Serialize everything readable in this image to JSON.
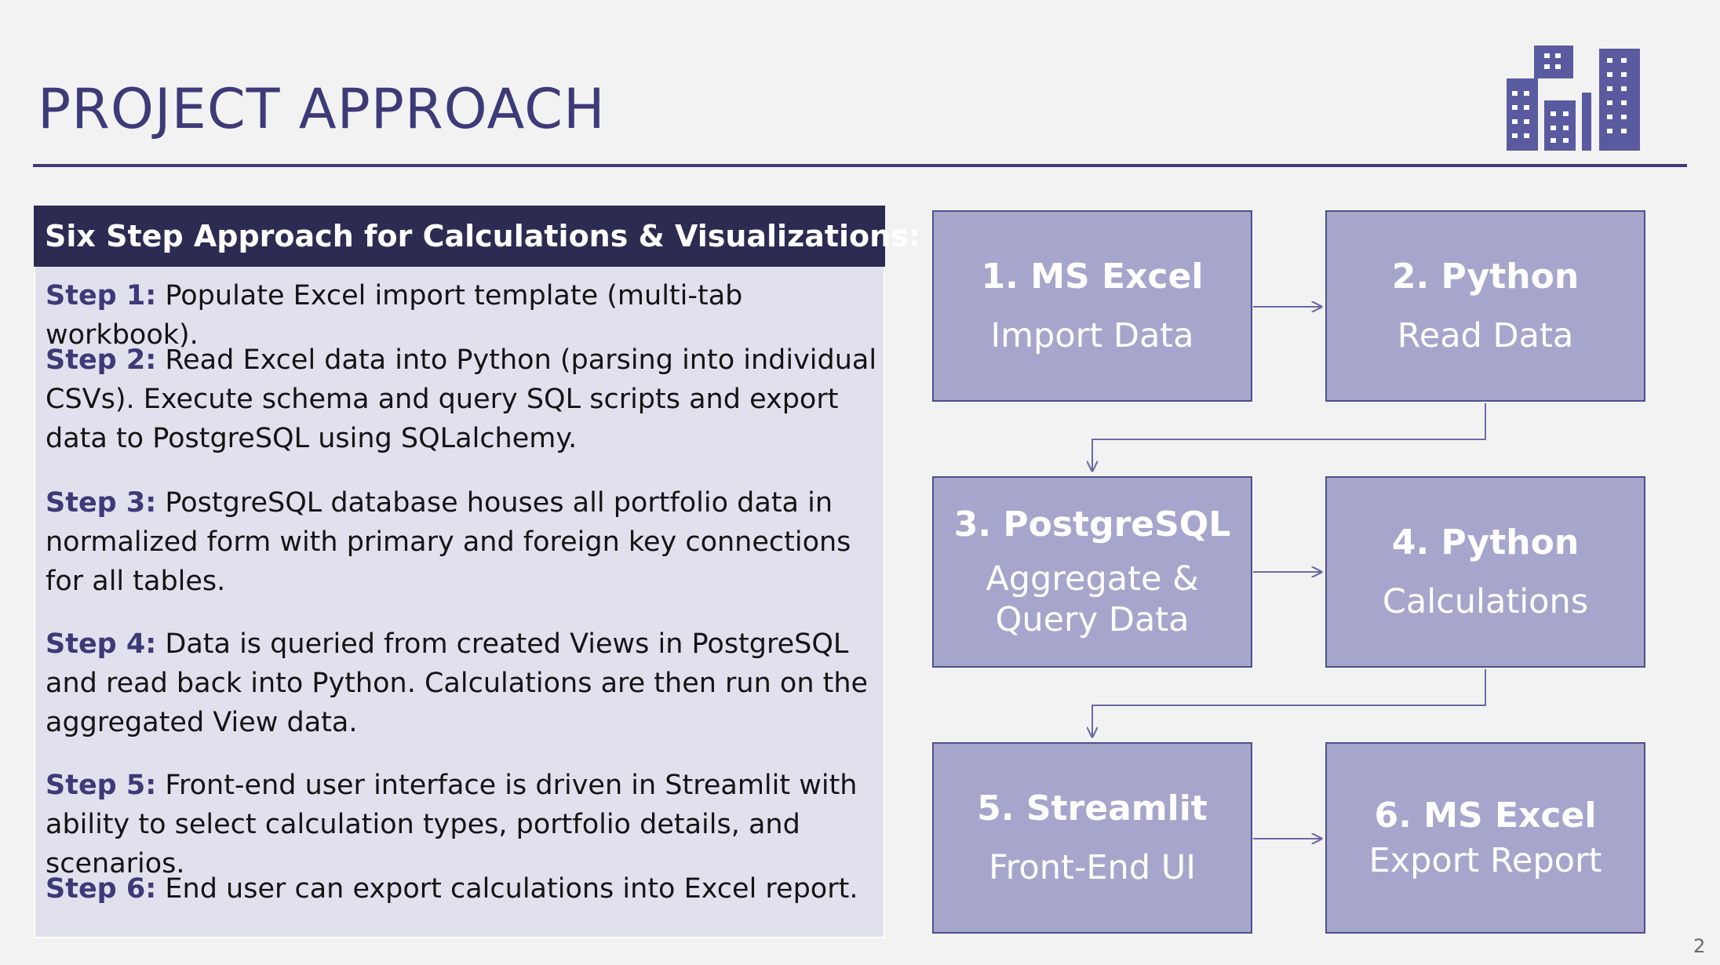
{
  "slide": {
    "title": "PROJECT APPROACH",
    "page_number": "2",
    "logo_icon": "buildings-icon"
  },
  "left_panel": {
    "header": "Six Step Approach for Calculations & Visualizations:",
    "steps": [
      {
        "label": "Step 1:",
        "text": " Populate Excel import template (multi-tab workbook)."
      },
      {
        "label": "Step 2:",
        "text": " Read Excel data into Python (parsing into individual CSVs). Execute schema and query SQL scripts and export data to PostgreSQL using SQLalchemy."
      },
      {
        "label": "Step 3:",
        "text": " PostgreSQL database houses all portfolio data in normalized form with primary and foreign key connections for all tables."
      },
      {
        "label": "Step 4:",
        "text": " Data is queried from created Views in PostgreSQL and read back into Python.  Calculations are then run on the aggregated View data."
      },
      {
        "label": "Step 5:",
        "text": " Front-end user interface is driven in Streamlit with ability to select calculation types, portfolio details, and scenarios."
      },
      {
        "label": "Step 6:",
        "text": " End user can export calculations into Excel report."
      }
    ]
  },
  "flow": {
    "boxes": [
      {
        "title": "1. MS Excel",
        "subtitle": "Import Data"
      },
      {
        "title": "2. Python",
        "subtitle": "Read Data"
      },
      {
        "title": "3. PostgreSQL",
        "subtitle": "Aggregate & Query Data"
      },
      {
        "title": "4. Python",
        "subtitle": "Calculations"
      },
      {
        "title": "5. Streamlit",
        "subtitle": "Front-End UI"
      },
      {
        "title": "6. MS Excel",
        "subtitle": "Export Report"
      }
    ]
  },
  "colors": {
    "accent": "#3d3a78",
    "header_bg": "#2c2b52",
    "panel_bg": "#e1e1ee",
    "box_fill": "#a6a6cc",
    "box_border": "#4f4f8f",
    "background": "#f2f2f2"
  }
}
